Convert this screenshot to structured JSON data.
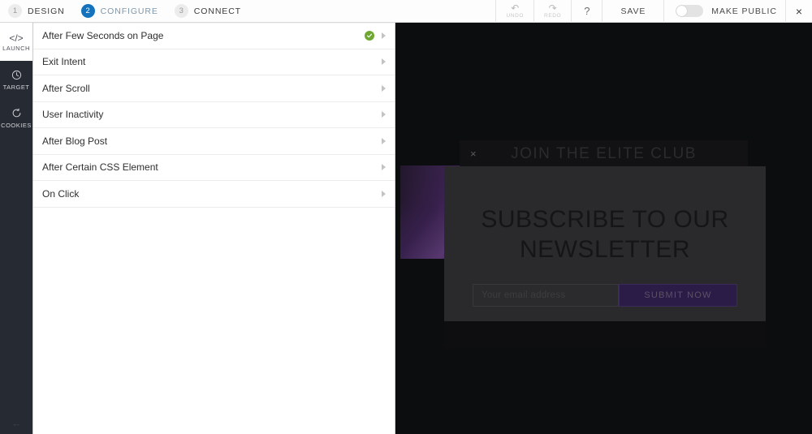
{
  "wizard": {
    "steps": [
      {
        "num": "1",
        "label": "DESIGN",
        "active": false
      },
      {
        "num": "2",
        "label": "CONFIGURE",
        "active": true
      },
      {
        "num": "3",
        "label": "CONNECT",
        "active": false
      }
    ]
  },
  "toolbar": {
    "undo_label": "UNDO",
    "undo_icon": "undo-arrow",
    "redo_label": "REDO",
    "redo_icon": "redo-arrow",
    "help_label": "?",
    "save_label": "SAVE",
    "make_public_label": "MAKE PUBLIC",
    "toggle_state": "off",
    "close_label": "×"
  },
  "sidebar": {
    "items": [
      {
        "icon": "code-brackets-icon",
        "glyph": "</>",
        "label": "LAUNCH",
        "selected": true
      },
      {
        "icon": "clock-icon",
        "glyph": "◔",
        "label": "TARGET",
        "selected": false
      },
      {
        "icon": "cookie-refresh-icon",
        "glyph": "↺",
        "label": "COOKIES",
        "selected": false
      }
    ],
    "collapse_icon": "back-arrow-icon"
  },
  "triggers": {
    "rows": [
      {
        "label": "After Few Seconds on Page",
        "enabled": true
      },
      {
        "label": "Exit Intent",
        "enabled": false
      },
      {
        "label": "After Scroll",
        "enabled": false
      },
      {
        "label": "User Inactivity",
        "enabled": false
      },
      {
        "label": "After Blog Post",
        "enabled": false
      },
      {
        "label": "After Certain CSS Element",
        "enabled": false
      },
      {
        "label": "On Click",
        "enabled": false
      }
    ]
  },
  "preview": {
    "bar_title": "JOIN THE ELITE CLUB",
    "bar_close": "×",
    "headline": "SUBSCRIBE TO OUR NEWSLETTER",
    "email_placeholder": "Your email address",
    "submit_label": "SUBMIT NOW"
  },
  "colors": {
    "accent_blue": "#1573bd",
    "check_green": "#6ea832",
    "sidebar_dark": "#262b33",
    "preview_bg": "#0c0d0f",
    "card_bg": "#2a2a2c",
    "submit_purple": "#2a1c46"
  }
}
